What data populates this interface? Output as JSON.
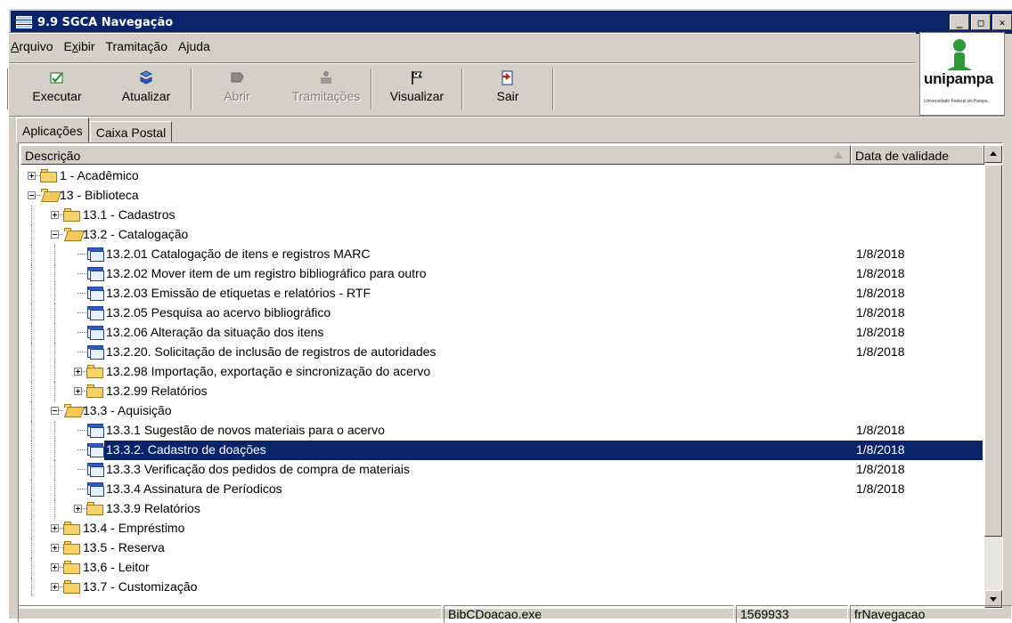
{
  "window": {
    "title": "9.9 SGCA Navegação",
    "min_label": "_",
    "max_label": "□",
    "close_label": "✕"
  },
  "menu": [
    {
      "label": "Arquivo",
      "mnemonic": "A",
      "rest": "rquivo"
    },
    {
      "label": "Exibir",
      "pre": "E",
      "mnemonic": "x",
      "rest": "ibir"
    },
    {
      "label": "Tramitação",
      "pre": "",
      "mnemonic": "",
      "rest": "Tramitação"
    },
    {
      "label": "Ajuda",
      "pre": "A",
      "mnemonic": "j",
      "rest": "uda"
    }
  ],
  "toolbar": [
    {
      "label": "Executar",
      "enabled": true,
      "icon": "execute-icon"
    },
    {
      "label": "Atualizar",
      "enabled": true,
      "icon": "refresh-icon"
    },
    {
      "label": "Abrir",
      "enabled": false,
      "icon": "open-icon"
    },
    {
      "label": "Tramitações",
      "enabled": false,
      "icon": "tramitacoes-icon"
    },
    {
      "label": "Visualizar",
      "enabled": true,
      "icon": "view-flag-icon"
    },
    {
      "label": "Sair",
      "enabled": true,
      "icon": "exit-door-icon"
    }
  ],
  "logo": {
    "name": "unipampa",
    "subtitle": "Universidade Federal do Pampa"
  },
  "tabs": [
    {
      "label": "Aplicações",
      "active": true
    },
    {
      "label": "Caixa Postal",
      "active": false
    }
  ],
  "columns": {
    "description": "Descrição",
    "validity": "Data de validade"
  },
  "tree": [
    {
      "level": 0,
      "type": "folder",
      "exp": "plus",
      "label": "1 - Acadêmico",
      "date": ""
    },
    {
      "level": 0,
      "type": "folder-open",
      "exp": "minus",
      "label": "13 - Biblioteca",
      "date": ""
    },
    {
      "level": 1,
      "type": "folder",
      "exp": "plus",
      "label": "13.1 - Cadastros",
      "date": ""
    },
    {
      "level": 1,
      "type": "folder-open",
      "exp": "minus",
      "label": "13.2 - Catalogação",
      "date": ""
    },
    {
      "level": 2,
      "type": "doc",
      "exp": "",
      "label": "13.2.01 Catalogação de itens e registros MARC",
      "date": "1/8/2018"
    },
    {
      "level": 2,
      "type": "doc",
      "exp": "",
      "label": "13.2.02 Mover item de um registro bibliográfico para outro",
      "date": "1/8/2018"
    },
    {
      "level": 2,
      "type": "doc",
      "exp": "",
      "label": "13.2.03 Emissão de etiquetas e relatórios - RTF",
      "date": "1/8/2018"
    },
    {
      "level": 2,
      "type": "doc",
      "exp": "",
      "label": "13.2.05 Pesquisa ao acervo bibliográfico",
      "date": "1/8/2018"
    },
    {
      "level": 2,
      "type": "doc",
      "exp": "",
      "label": "13.2.06 Alteração da situação dos itens",
      "date": "1/8/2018"
    },
    {
      "level": 2,
      "type": "doc",
      "exp": "",
      "label": "13.2.20. Solicitação de inclusão de registros de autoridades",
      "date": "1/8/2018"
    },
    {
      "level": 2,
      "type": "folder",
      "exp": "plus",
      "label": "13.2.98 Importação, exportação e sincronização do acervo",
      "date": ""
    },
    {
      "level": 2,
      "type": "folder",
      "exp": "plus",
      "label": "13.2.99 Relatórios",
      "date": ""
    },
    {
      "level": 1,
      "type": "folder-open",
      "exp": "minus",
      "label": "13.3 - Aquisição",
      "date": ""
    },
    {
      "level": 2,
      "type": "doc",
      "exp": "",
      "label": "13.3.1 Sugestão de novos materiais para o acervo",
      "date": "1/8/2018"
    },
    {
      "level": 2,
      "type": "doc",
      "exp": "",
      "label": "13.3.2. Cadastro de doações",
      "date": "1/8/2018",
      "selected": true
    },
    {
      "level": 2,
      "type": "doc",
      "exp": "",
      "label": "13.3.3 Verificação dos pedidos de compra de materiais",
      "date": "1/8/2018"
    },
    {
      "level": 2,
      "type": "doc",
      "exp": "",
      "label": "13.3.4 Assinatura de Períodicos",
      "date": "1/8/2018"
    },
    {
      "level": 2,
      "type": "folder",
      "exp": "plus",
      "label": "13.3.9 Relatórios",
      "date": ""
    },
    {
      "level": 1,
      "type": "folder",
      "exp": "plus",
      "label": "13.4 - Empréstimo",
      "date": ""
    },
    {
      "level": 1,
      "type": "folder",
      "exp": "plus",
      "label": "13.5 - Reserva",
      "date": ""
    },
    {
      "level": 1,
      "type": "folder",
      "exp": "plus",
      "label": "13.6 - Leitor",
      "date": ""
    },
    {
      "level": 1,
      "type": "folder",
      "exp": "plus",
      "label": "13.7 - Customização",
      "date": ""
    }
  ],
  "status": {
    "cell1": "",
    "exe": "BibCDoacao.exe",
    "code": "1569933",
    "form": "frNavegacao"
  },
  "colors": {
    "title_bg": "#0a246a",
    "selection_bg": "#0a246a",
    "face": "#d4d0c8"
  }
}
